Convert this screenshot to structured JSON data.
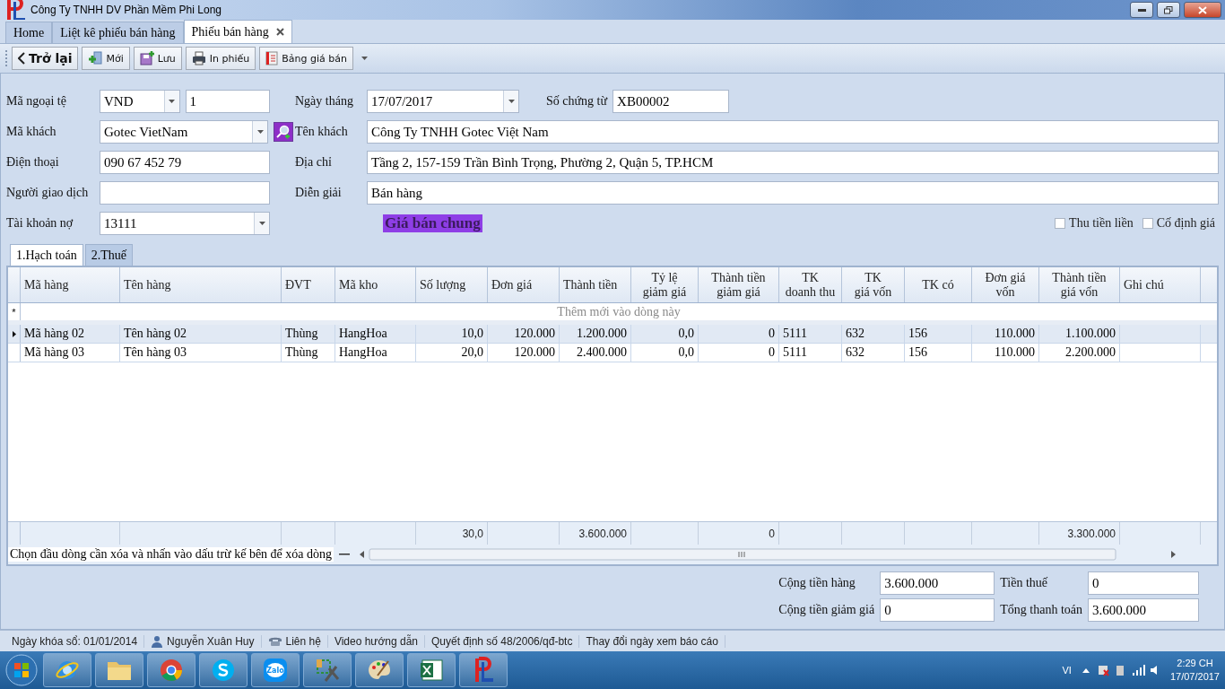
{
  "window": {
    "title": "Công Ty TNHH DV Phần Mềm Phi Long"
  },
  "tabs": [
    {
      "label": "Home",
      "selected": false,
      "closable": false
    },
    {
      "label": "Liệt kê phiếu bán hàng",
      "selected": false,
      "closable": false
    },
    {
      "label": "Phiếu bán hàng",
      "selected": true,
      "closable": true
    }
  ],
  "toolbar": [
    {
      "kind": "back",
      "label": "Trở lại"
    },
    {
      "kind": "new",
      "label": "Mới"
    },
    {
      "kind": "save",
      "label": "Lưu"
    },
    {
      "kind": "print",
      "label": "In phiếu"
    },
    {
      "kind": "pricelist",
      "label": "Bảng giá bán"
    }
  ],
  "left_fields": [
    {
      "kind": "currency",
      "label": "Mã ngoại tệ",
      "value": "VND",
      "rate": "1"
    },
    {
      "kind": "lookup",
      "label": "Mã khách",
      "value": "Gotec VietNam"
    },
    {
      "kind": "text",
      "label": "Điện thoại",
      "value": "090 67 452 79"
    },
    {
      "kind": "text",
      "label": "Người giao dịch"
    },
    {
      "kind": "combo",
      "label": "Tài khoản nợ",
      "value": "13111"
    }
  ],
  "right_fields": [
    {
      "kind": "date",
      "label": "Ngày tháng",
      "value": "17/07/2017",
      "extra_label": "Số chứng từ",
      "extra_value": "XB00002"
    },
    {
      "kind": "text",
      "label": "Tên khách",
      "value": "Công Ty TNHH Gotec Việt Nam"
    },
    {
      "kind": "text",
      "label": "Địa chỉ",
      "value": "Tầng 2, 157-159 Trần Bình Trọng, Phường 2, Quận 5, TP.HCM"
    },
    {
      "kind": "text",
      "label": "Diễn giải",
      "value": "Bán hàng"
    }
  ],
  "price_list": "Giá bán chung",
  "options": [
    {
      "label": "Thu tiền liền",
      "checked": false
    },
    {
      "label": "Cố định giá",
      "checked": false
    }
  ],
  "detail_tabs": [
    {
      "label": "1.Hạch toán",
      "selected": true
    },
    {
      "label": "2.Thuế",
      "selected": false
    }
  ],
  "grid": {
    "columns": [
      {
        "label": "Mã hàng"
      },
      {
        "label": "Tên hàng"
      },
      {
        "label": "ĐVT"
      },
      {
        "label": "Mã kho"
      },
      {
        "label": "Số lượng",
        "total": "30,0"
      },
      {
        "label": "Đơn giá"
      },
      {
        "label": "Thành tiền",
        "total": "3.600.000"
      },
      {
        "label": "Tỷ lệ\ngiảm giá"
      },
      {
        "label": "Thành tiền\ngiảm giá",
        "total": "0"
      },
      {
        "label": "TK\ndoanh thu"
      },
      {
        "label": "TK\ngiá vốn"
      },
      {
        "label": "TK có"
      },
      {
        "label": "Đơn giá\nvốn"
      },
      {
        "label": "Thành tiền\ngiá vốn",
        "total": "3.300.000"
      },
      {
        "label": "Ghi chú"
      }
    ],
    "new_row_hint": "Thêm mới vào dòng này",
    "new_row_mark": "*",
    "rows": [
      {
        "selected": true,
        "cells": [
          "Mã hàng 02",
          "Tên hàng 02",
          "Thùng",
          "HangHoa",
          "10,0",
          "120.000",
          "1.200.000",
          "0,0",
          "0",
          "5111",
          "632",
          "156",
          "110.000",
          "1.100.000"
        ]
      },
      {
        "selected": false,
        "cells": [
          "Mã hàng 03",
          "Tên hàng 03",
          "Thùng",
          "HangHoa",
          "20,0",
          "120.000",
          "2.400.000",
          "0,0",
          "0",
          "5111",
          "632",
          "156",
          "110.000",
          "2.200.000"
        ]
      }
    ],
    "delete_hint": "Chọn đầu dòng cần xóa và nhấn vào dấu trừ kế bên để xóa dòng"
  },
  "summary": [
    {
      "label": "Cộng tiền hàng",
      "value": "3.600.000"
    },
    {
      "label": "Tiền thuế",
      "value": "0"
    },
    {
      "label": "Cộng tiền giảm giá",
      "value": "0"
    },
    {
      "label": "Tổng thanh toán",
      "value": "3.600.000"
    }
  ],
  "status_bar": [
    {
      "kind": "plain",
      "label": "Ngày khóa sổ: 01/01/2014"
    },
    {
      "kind": "user",
      "label": "Nguyễn Xuân Huy"
    },
    {
      "kind": "phone",
      "label": "Liên hệ"
    },
    {
      "kind": "plain",
      "label": "Video hướng dẫn"
    },
    {
      "kind": "plain",
      "label": "Quyết định số 48/2006/qđ-btc"
    },
    {
      "kind": "plain",
      "label": "Thay đổi ngày xem báo cáo"
    }
  ],
  "taskbar": {
    "apps": [
      {
        "kind": "ie"
      },
      {
        "kind": "folder"
      },
      {
        "kind": "chrome"
      },
      {
        "kind": "skype"
      },
      {
        "kind": "zalo",
        "label": "Zalo"
      },
      {
        "kind": "tools"
      },
      {
        "kind": "paint"
      },
      {
        "kind": "excel"
      },
      {
        "kind": "pl"
      }
    ],
    "language": "VI",
    "time": "2:29 CH",
    "date": "17/07/2017"
  }
}
